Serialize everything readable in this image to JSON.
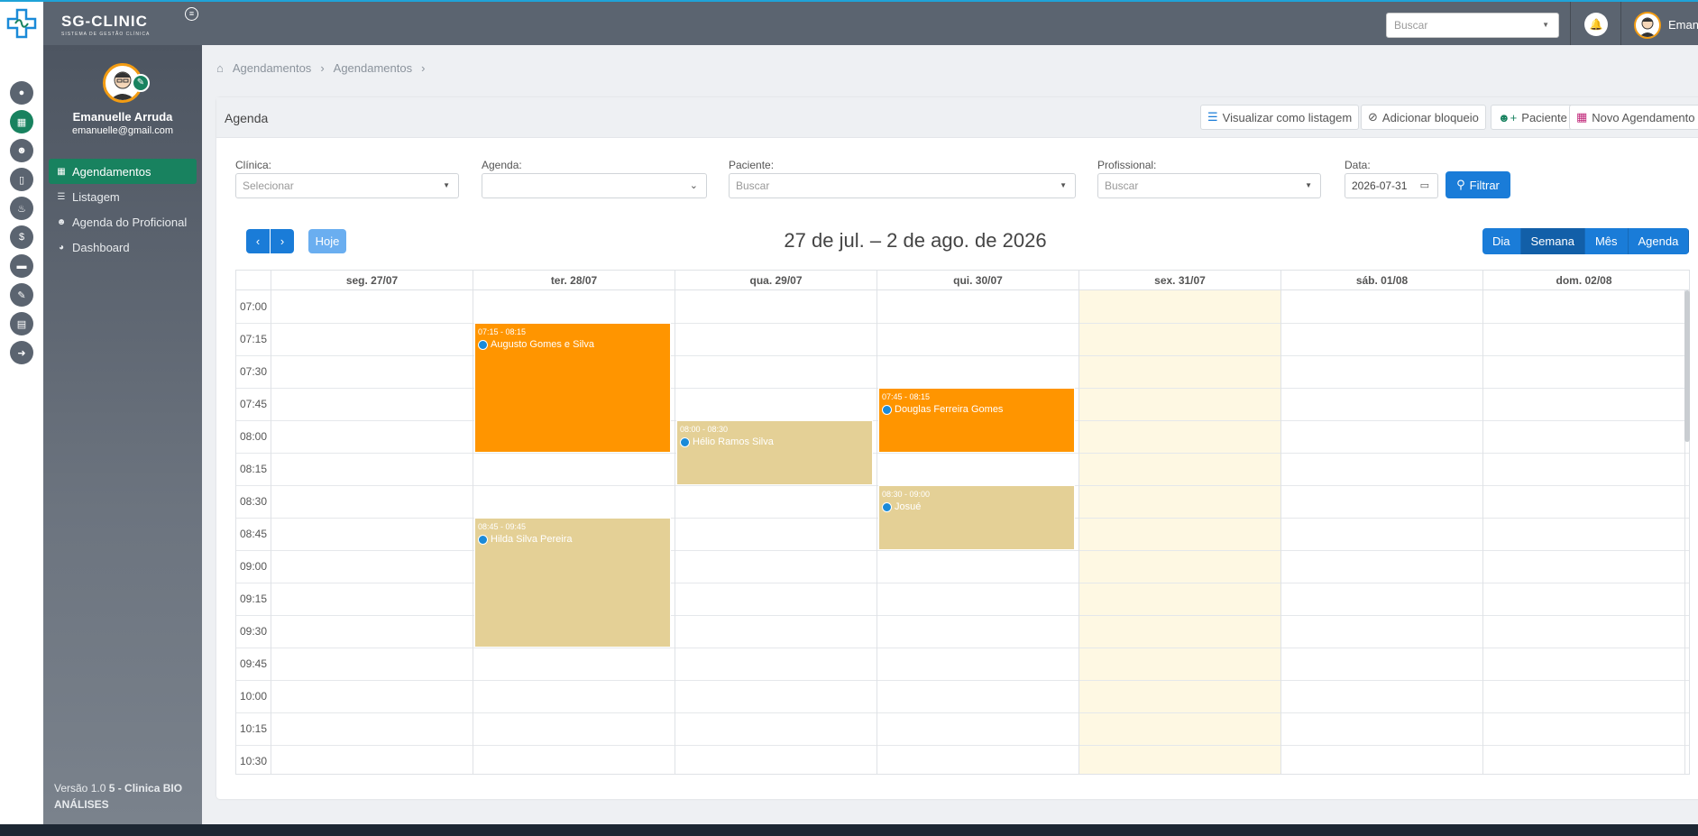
{
  "brand": {
    "name": "SG-CLINIC",
    "subtitle": "SISTEMA DE GESTÃO CLÍNICA"
  },
  "topbar": {
    "search_placeholder": "Buscar",
    "user_short": "Eman"
  },
  "sidebar": {
    "user_name": "Emanuelle Arruda",
    "user_email": "emanuelle@gmail.com",
    "items": [
      {
        "label": "Agendamentos",
        "icon": "calendar-icon",
        "active": true
      },
      {
        "label": "Listagem",
        "icon": "list-icon",
        "active": false
      },
      {
        "label": "Agenda do Proficional",
        "icon": "users-icon",
        "active": false
      },
      {
        "label": "Dashboard",
        "icon": "pie-chart-icon",
        "active": false
      }
    ],
    "version_prefix": "Versão 1.0",
    "version_suffix": "5 - Clinica BIO ANÁLISES"
  },
  "breadcrumb": [
    "Agendamentos",
    "Agendamentos"
  ],
  "card": {
    "title": "Agenda",
    "actions": [
      "Visualizar como listagem",
      "Adicionar bloqueio",
      "Paciente",
      "Novo Agendamento"
    ]
  },
  "filters": {
    "clinica": {
      "label": "Clínica:",
      "placeholder": "Selecionar"
    },
    "agenda": {
      "label": "Agenda:",
      "value": ""
    },
    "paciente": {
      "label": "Paciente:",
      "placeholder": "Buscar"
    },
    "profissional": {
      "label": "Profissional:",
      "placeholder": "Buscar"
    },
    "data": {
      "label": "Data:",
      "value": "2026-07-31"
    },
    "button": "Filtrar"
  },
  "calendar": {
    "today_label": "Hoje",
    "range_title": "27 de jul. – 2 de ago. de 2026",
    "views": [
      "Dia",
      "Semana",
      "Mês",
      "Agenda"
    ],
    "active_view": "Semana",
    "days": [
      "seg. 27/07",
      "ter. 28/07",
      "qua. 29/07",
      "qui. 30/07",
      "sex. 31/07",
      "sáb. 01/08",
      "dom. 02/08"
    ],
    "today_index": 4,
    "times": [
      "07:00",
      "07:15",
      "07:30",
      "07:45",
      "08:00",
      "08:15",
      "08:30",
      "08:45",
      "09:00",
      "09:15",
      "09:30",
      "09:45",
      "10:00",
      "10:15",
      "10:30"
    ],
    "events": [
      {
        "day": 1,
        "start": "07:15",
        "end": "08:15",
        "time": "07:15 - 08:15",
        "patient": "Augusto Gomes e Silva",
        "color": "#ff9500",
        "style": "orange"
      },
      {
        "day": 2,
        "start": "08:00",
        "end": "08:30",
        "time": "08:00 - 08:30",
        "patient": "Hélio Ramos Silva",
        "color": "#e4d096",
        "style": "tan"
      },
      {
        "day": 3,
        "start": "07:45",
        "end": "08:15",
        "time": "07:45 - 08:15",
        "patient": "Douglas Ferreira Gomes",
        "color": "#ff9500",
        "style": "orange"
      },
      {
        "day": 3,
        "start": "08:30",
        "end": "09:00",
        "time": "08:30 - 09:00",
        "patient": "Josué",
        "color": "#e4d096",
        "style": "tan"
      },
      {
        "day": 1,
        "start": "08:45",
        "end": "09:45",
        "time": "08:45 - 09:45",
        "patient": "Hilda Silva Pereira",
        "color": "#e4d096",
        "style": "tan"
      }
    ]
  },
  "colors": {
    "primary": "#1a7cd8",
    "sidebar_active": "#18825f",
    "topbar": "#5b6470",
    "today_bg": "#fef8e3"
  }
}
